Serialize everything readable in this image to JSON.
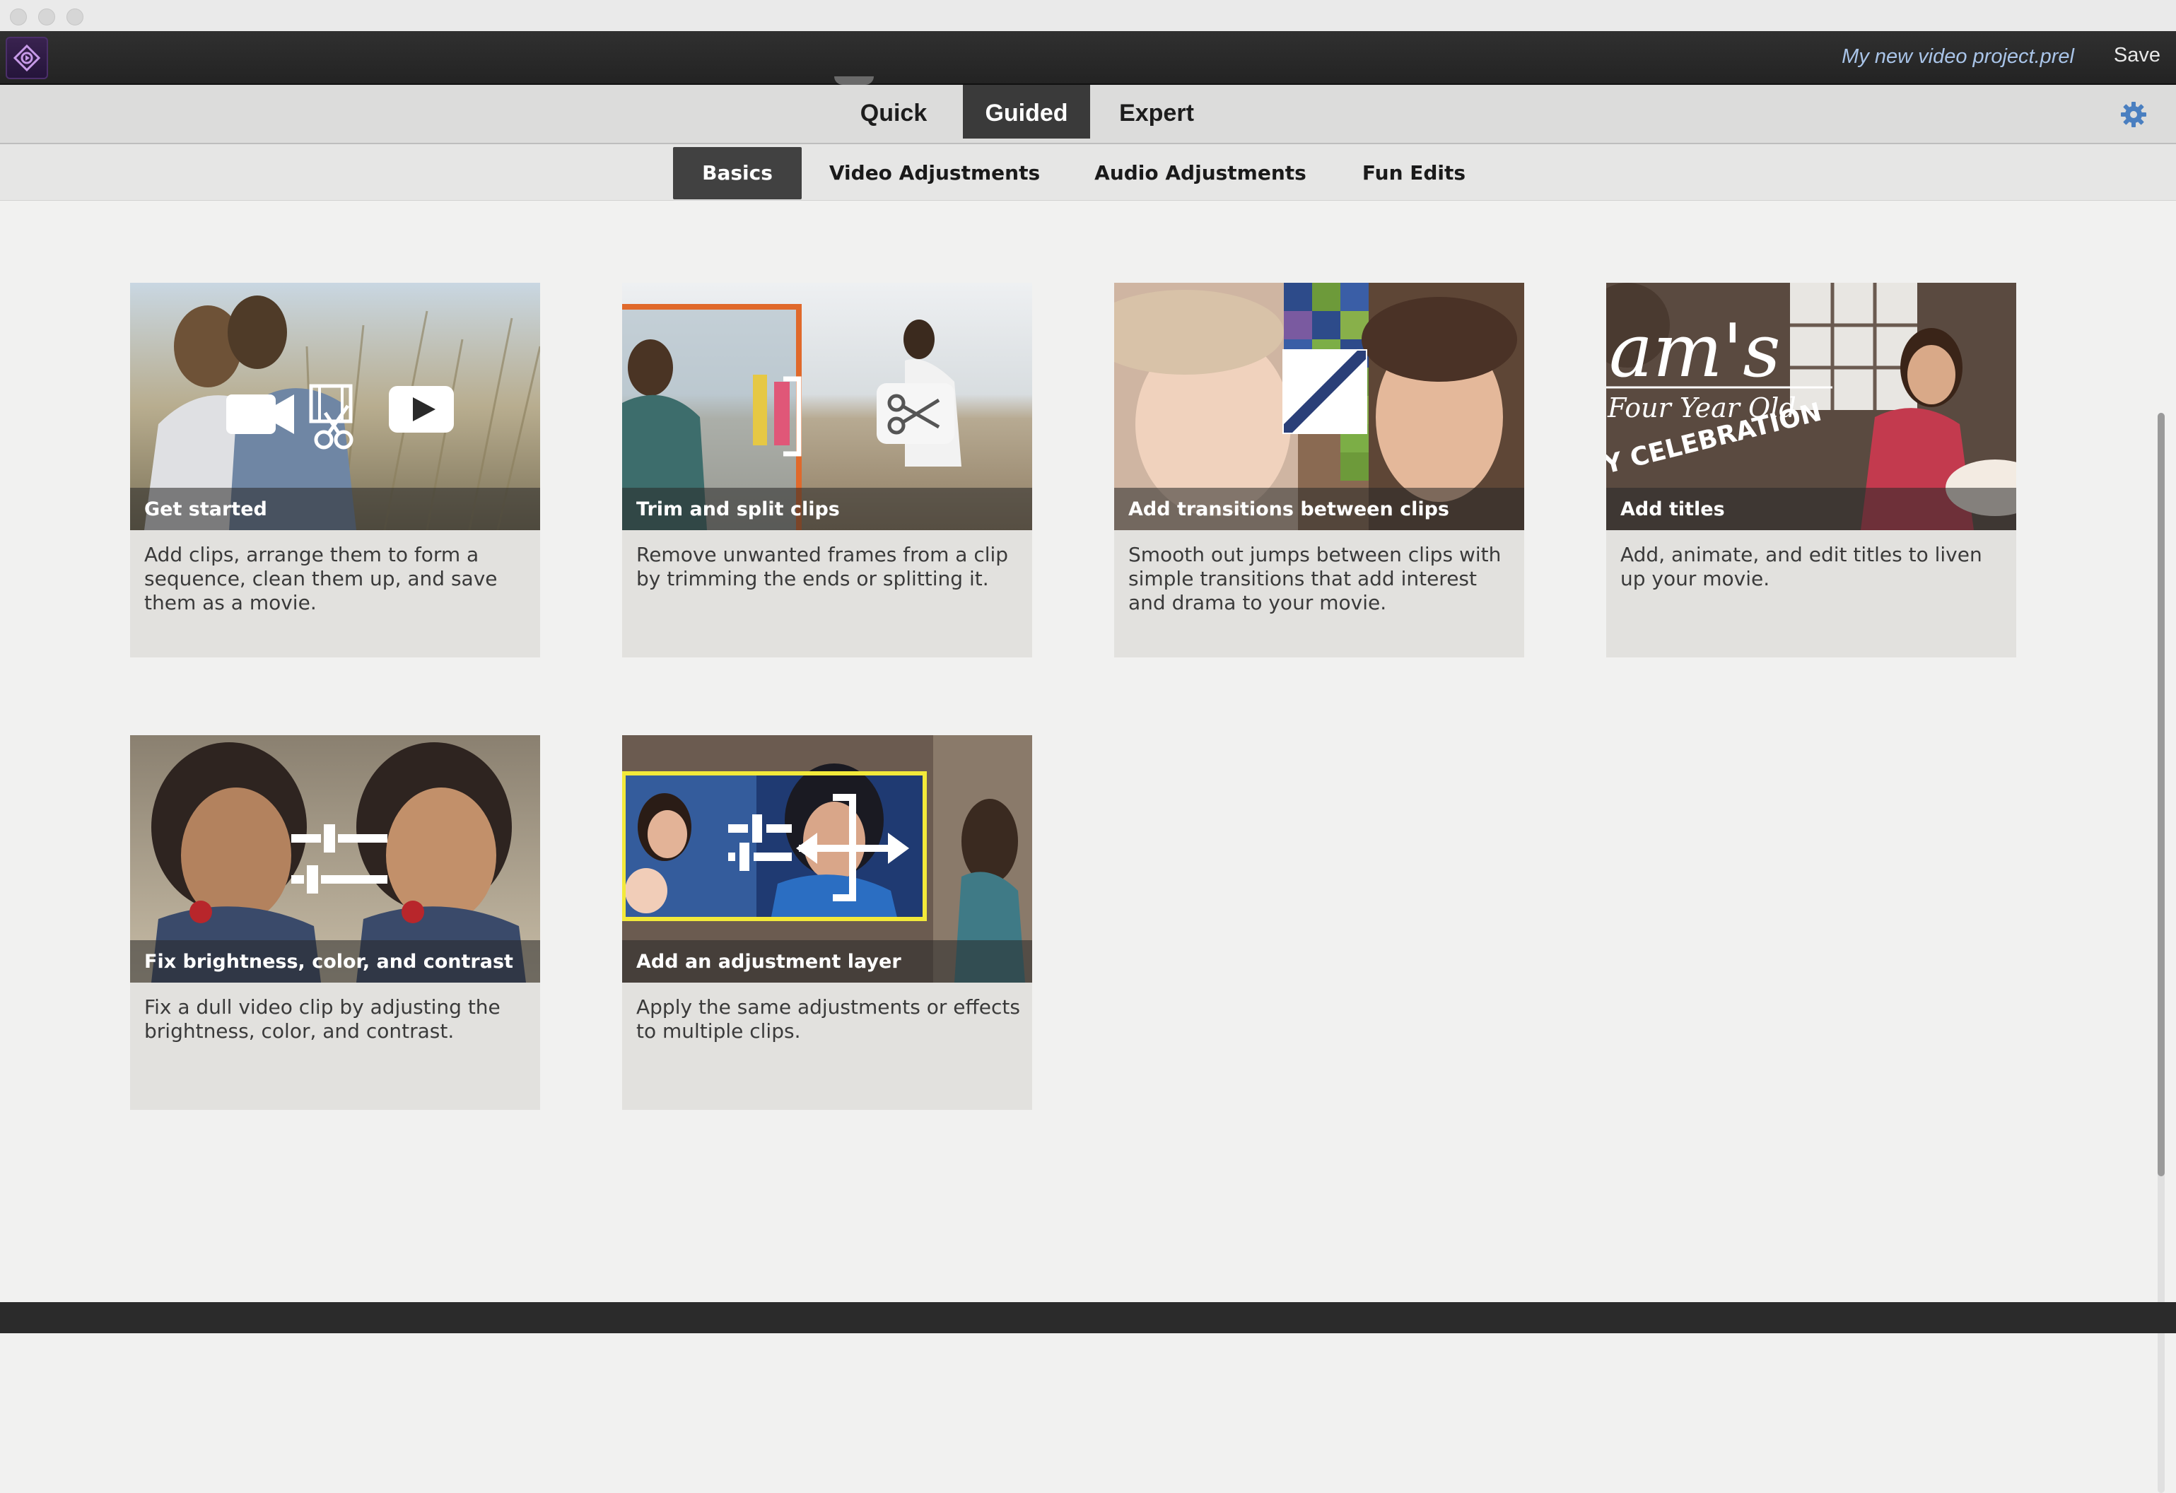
{
  "window": {
    "project_name": "My new video project.prel",
    "save_label": "Save"
  },
  "modes": [
    {
      "label": "Quick",
      "active": false
    },
    {
      "label": "Guided",
      "active": true
    },
    {
      "label": "Expert",
      "active": false
    }
  ],
  "subtabs": [
    {
      "label": "Basics",
      "active": true
    },
    {
      "label": "Video Adjustments",
      "active": false
    },
    {
      "label": "Audio Adjustments",
      "active": false
    },
    {
      "label": "Fun Edits",
      "active": false
    }
  ],
  "cards": [
    {
      "title": "Get started",
      "description": "Add clips, arrange them to form a sequence, clean them up, and save them as a movie.",
      "icon": "camera-film-play-icons"
    },
    {
      "title": "Trim and split clips",
      "description": "Remove unwanted frames from a clip by trimming the ends or splitting it.",
      "icon": "scissors-icon"
    },
    {
      "title": "Add transitions between clips",
      "description": "Smooth out jumps between clips with simple transitions that add interest and drama to your movie.",
      "icon": "transition-icon"
    },
    {
      "title": "Add titles",
      "description": "Add, animate, and edit titles to liven up your movie.",
      "icon": "title-text-icon"
    },
    {
      "title": "Fix brightness, color, and contrast",
      "description": "Fix a dull video clip by adjusting the brightness, color, and contrast.",
      "icon": "sliders-icon"
    },
    {
      "title": "Add an adjustment layer",
      "description": "Apply the same adjustments or effects to multiple clips.",
      "icon": "adjustment-layer-icon"
    }
  ],
  "thumb_texts": {
    "title_big": "am's",
    "title_sub": "Four Year Old",
    "title_celebration": "Y CELEBRATION"
  },
  "colors": {
    "active_tab_bg": "#3a3a3a",
    "gear": "#4a7fc0",
    "project_name": "#a9c4e8"
  }
}
